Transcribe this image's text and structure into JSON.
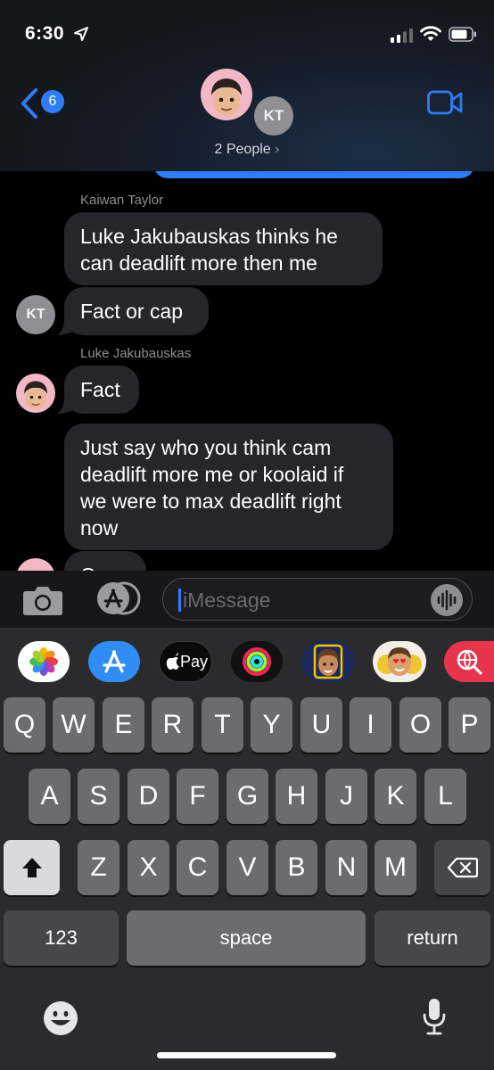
{
  "status_bar": {
    "time": "6:30"
  },
  "header": {
    "back_badge": "6",
    "kt_initials": "KT",
    "people_label": "2 People",
    "chevron": "›"
  },
  "messages": [
    {
      "sender": "Kaiwan Taylor",
      "text_lines": [
        "Luke Jakubauskas thinks he",
        "can deadlift more then me"
      ]
    },
    {
      "text": "Fact or cap",
      "avatar": "KT"
    },
    {
      "sender": "Luke Jakubauskas",
      "text": "Fact"
    },
    {
      "text_lines": [
        "Just say who you think cam",
        "deadlift more me or koolaid if",
        "we were to max deadlift right",
        "now"
      ]
    },
    {
      "text": "Cap"
    }
  ],
  "input": {
    "placeholder": "iMessage"
  },
  "app_row": {
    "apple_pay_label": "Pay"
  },
  "keyboard": {
    "row1": [
      "Q",
      "W",
      "E",
      "R",
      "T",
      "Y",
      "U",
      "I",
      "O",
      "P"
    ],
    "row2": [
      "A",
      "S",
      "D",
      "F",
      "G",
      "H",
      "J",
      "K",
      "L"
    ],
    "row3": [
      "Z",
      "X",
      "C",
      "V",
      "B",
      "N",
      "M"
    ],
    "numbers_label": "123",
    "space_label": "space",
    "return_label": "return"
  },
  "colors": {
    "accent": "#2f7cf6",
    "bubble": "#26252a",
    "key": "#6c6c70"
  }
}
